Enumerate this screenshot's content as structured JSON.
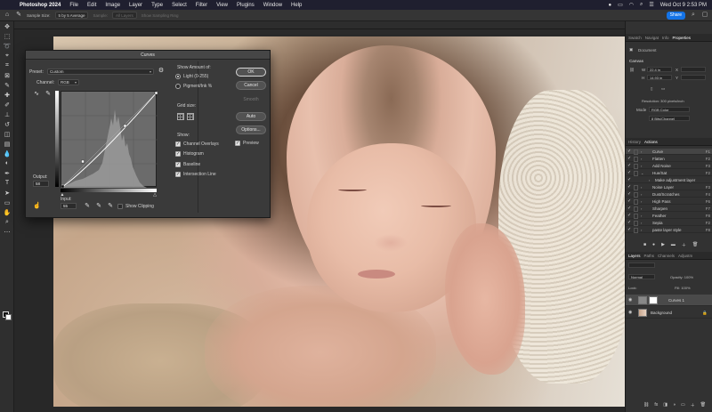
{
  "menubar": {
    "app_name": "Photoshop 2024",
    "items": [
      "File",
      "Edit",
      "Image",
      "Layer",
      "Type",
      "Select",
      "Filter",
      "View",
      "Plugins",
      "Window",
      "Help"
    ],
    "datetime": "Wed Oct 9  2:53 PM"
  },
  "options_bar": {
    "sample_size_label": "Sample Size:",
    "sample_size_value": "5 by 5 Average",
    "sample_label": "Sample:",
    "sample_value": "All Layers",
    "show_ring": "Show Sampling Ring",
    "share_label": "Share"
  },
  "document": {
    "tab_title": ""
  },
  "curves": {
    "title": "Curves",
    "preset_label": "Preset:",
    "preset_value": "Custom",
    "channel_label": "Channel:",
    "channel_value": "RGB",
    "output_label": "Output:",
    "output_value": "58",
    "input_label": "Input:",
    "input_value": "55",
    "show_clipping": "Show Clipping",
    "show_amount_label": "Show Amount of:",
    "light_label": "Light  (0-255)",
    "pigment_label": "Pigment/Ink %",
    "grid_size_label": "Grid size:",
    "show_label": "Show:",
    "channel_overlays": "Channel Overlays",
    "histogram": "Histogram",
    "baseline": "Baseline",
    "intersection_line": "Intersection Line",
    "ok": "OK",
    "cancel": "Cancel",
    "smooth": "Smooth",
    "auto": "Auto",
    "options": "Options...",
    "preview": "Preview"
  },
  "properties": {
    "tabs": [
      "Swatch",
      "Navigat",
      "Info",
      "Properties"
    ],
    "document_label": "Document",
    "canvas_label": "Canvas",
    "w_label": "W",
    "w_value": "22.4 in",
    "h_label": "H",
    "h_value": "14.93 in",
    "x_label": "X",
    "y_label": "Y",
    "resolution": "Resolution: 300 pixels/inch",
    "mode_label": "Mode",
    "mode_value": "RGB Color",
    "depth_value": "8 Bits/Channel"
  },
  "actions_panel": {
    "tabs": [
      "History",
      "Actions"
    ],
    "rows": [
      {
        "name": "Curve",
        "key": "F1",
        "sel": true
      },
      {
        "name": "Flatten",
        "key": "F2",
        "sel": false
      },
      {
        "name": "Add Noise",
        "key": "F3",
        "sel": false
      },
      {
        "name": "Hue/Sat",
        "key": "F2",
        "sel": false
      },
      {
        "name": "Make adjustment layer",
        "key": "",
        "sel": false
      },
      {
        "name": "Noise Layer",
        "key": "F3",
        "sel": false
      },
      {
        "name": "Dust/Scratches",
        "key": "F4",
        "sel": false
      },
      {
        "name": "High Pass",
        "key": "F6",
        "sel": false
      },
      {
        "name": "Sharpen",
        "key": "F7",
        "sel": false
      },
      {
        "name": "Feather",
        "key": "F8",
        "sel": false
      },
      {
        "name": "Sepia",
        "key": "F2",
        "sel": false
      },
      {
        "name": "paste layer style",
        "key": "F8",
        "sel": false
      }
    ]
  },
  "layers_panel": {
    "tabs": [
      "Layers",
      "Paths",
      "Channels",
      "Adjustm"
    ],
    "kind_label": "Normal",
    "opacity_label": "Opacity: 100%",
    "lock_label": "Lock:",
    "fill_label": "Fill: 100%",
    "layers": [
      {
        "name": "Curves 1",
        "sel": true
      },
      {
        "name": "Background",
        "sel": false
      }
    ]
  }
}
